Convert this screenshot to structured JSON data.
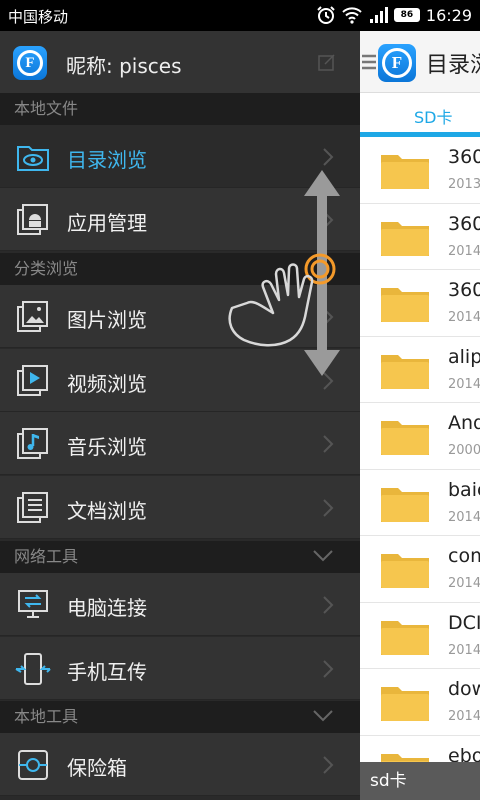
{
  "status_bar": {
    "carrier": "中国移动",
    "battery": "86",
    "time": "16:29",
    "icons": [
      "alarm-icon",
      "wifi-icon",
      "signal-icon",
      "battery-icon"
    ]
  },
  "drawer": {
    "nickname": "昵称: pisces",
    "sections": {
      "local_files": "本地文件",
      "category_browse": "分类浏览",
      "network_tools": "网络工具",
      "local_tools": "本地工具"
    },
    "items": [
      {
        "label": "目录浏览",
        "icon": "folder-eye-icon",
        "active": true
      },
      {
        "label": "应用管理",
        "icon": "android-app-icon"
      },
      {
        "label": "图片浏览",
        "icon": "image-icon"
      },
      {
        "label": "视频浏览",
        "icon": "video-icon"
      },
      {
        "label": "音乐浏览",
        "icon": "music-icon"
      },
      {
        "label": "文档浏览",
        "icon": "document-icon"
      },
      {
        "label": "电脑连接",
        "icon": "computer-connect-icon"
      },
      {
        "label": "手机互传",
        "icon": "phone-transfer-icon"
      },
      {
        "label": "保险箱",
        "icon": "safe-box-icon"
      }
    ]
  },
  "main": {
    "title": "目录浏",
    "tab": "SD卡",
    "files": [
      {
        "name": "360",
        "date": "2013"
      },
      {
        "name": "360",
        "date": "2014"
      },
      {
        "name": "360",
        "date": "2014"
      },
      {
        "name": "alip",
        "date": "2014"
      },
      {
        "name": "And",
        "date": "2000"
      },
      {
        "name": "baic",
        "date": "2014"
      },
      {
        "name": "com",
        "date": "2014"
      },
      {
        "name": "DCI",
        "date": "2014"
      },
      {
        "name": "dow",
        "date": "2014"
      },
      {
        "name": "ebo",
        "date": ""
      }
    ],
    "path": "sd卡"
  },
  "colors": {
    "accent": "#1ea8e6",
    "active_label": "#3fb7ee",
    "drawer_bg": "#333333",
    "section_bg": "#1e1e1e",
    "folder": "#f6c64e",
    "gesture": "#f49a2a"
  }
}
